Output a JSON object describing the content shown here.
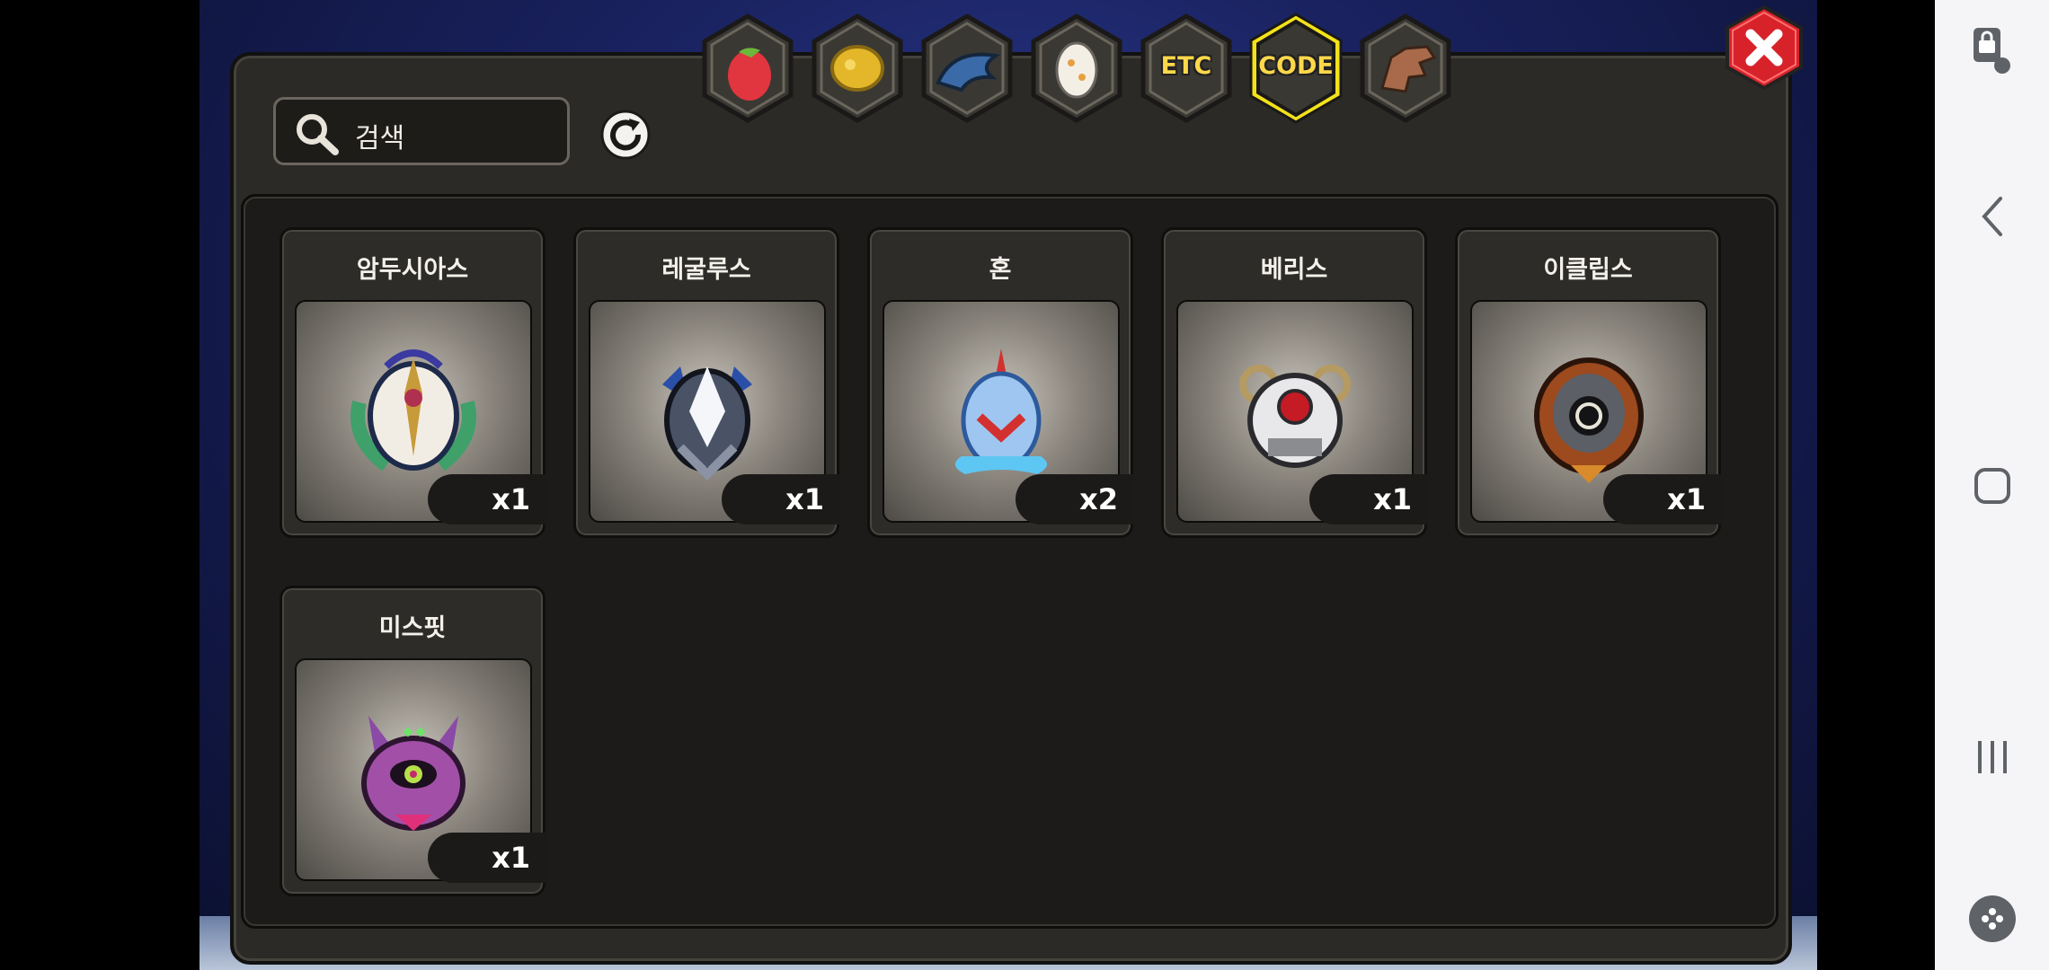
{
  "search": {
    "placeholder": "검색"
  },
  "tabs": [
    {
      "label": "",
      "icon": "fruit-icon"
    },
    {
      "label": "",
      "icon": "gold-ore-icon"
    },
    {
      "label": "",
      "icon": "dragon-scale-icon"
    },
    {
      "label": "",
      "icon": "egg-icon"
    },
    {
      "label": "ETC",
      "icon": "etc-icon"
    },
    {
      "label": "CODE",
      "icon": "code-icon",
      "selected": true
    },
    {
      "label": "",
      "icon": "dragon-head-icon"
    }
  ],
  "items": [
    {
      "name": "암두시아스",
      "count": "x1",
      "icon": "amdusias-emblem-icon"
    },
    {
      "name": "레굴루스",
      "count": "x1",
      "icon": "regulus-emblem-icon"
    },
    {
      "name": "혼",
      "count": "x2",
      "icon": "hon-emblem-icon"
    },
    {
      "name": "베리스",
      "count": "x1",
      "icon": "beris-emblem-icon"
    },
    {
      "name": "이클립스",
      "count": "x1",
      "icon": "eclipse-emblem-icon"
    },
    {
      "name": "미스핏",
      "count": "x1",
      "icon": "misfit-emblem-icon"
    }
  ],
  "colors": {
    "selected_tab_border": "#f3e21b",
    "close_red": "#d8222a",
    "label_yellow": "#ffd84a"
  }
}
